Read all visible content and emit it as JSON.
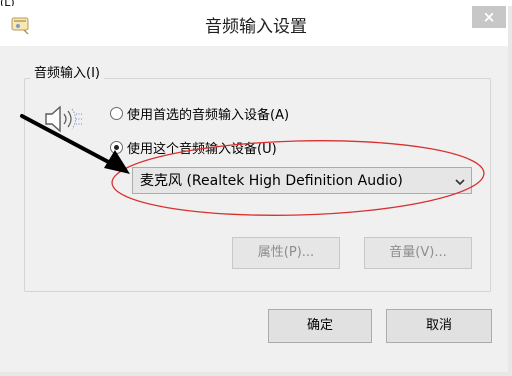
{
  "top_fragment": "(L)",
  "window": {
    "title": "音频输入设置",
    "close_symbol": "×"
  },
  "group": {
    "label": "音频输入(I)",
    "radio_preferred": "使用首选的音频输入设备(A)",
    "radio_this": "使用这个音频输入设备(U)",
    "selected_radio": "radio_this",
    "device_select_value": "麦克风 (Realtek High Definition Audio)",
    "properties_button": "属性(P)...",
    "volume_button": "音量(V)..."
  },
  "footer": {
    "ok_button": "确定",
    "cancel_button": "取消"
  },
  "colors": {
    "annotation_ellipse": "#d93030",
    "annotation_arrow": "#000000",
    "close_button_bg": "#c7c7c7",
    "dialog_bg": "#f0f0f0"
  },
  "icons": {
    "app": "dialog-app-icon",
    "speaker": "speaker-sound-icon",
    "dropdown": "chevron-down-icon"
  }
}
